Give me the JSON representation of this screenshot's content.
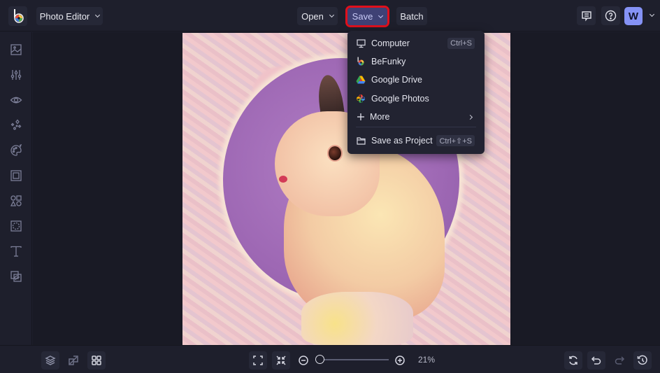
{
  "header": {
    "app_name": "Photo Editor",
    "open_label": "Open",
    "save_label": "Save",
    "batch_label": "Batch",
    "avatar_initial": "W"
  },
  "save_menu": {
    "items": [
      {
        "label": "Computer",
        "icon": "monitor-icon",
        "shortcut": "Ctrl+S"
      },
      {
        "label": "BeFunky",
        "icon": "befunky-logo-icon",
        "shortcut": ""
      },
      {
        "label": "Google Drive",
        "icon": "google-drive-icon",
        "shortcut": ""
      },
      {
        "label": "Google Photos",
        "icon": "google-photos-icon",
        "shortcut": ""
      },
      {
        "label": "More",
        "icon": "plus-icon",
        "shortcut": "",
        "submenu": true
      },
      {
        "label": "Save as Project",
        "icon": "folder-icon",
        "shortcut": "Ctrl+⇧+S"
      }
    ]
  },
  "sidebar": {
    "items": [
      {
        "name": "image-manager",
        "icon": "image-icon"
      },
      {
        "name": "edit",
        "icon": "sliders-icon"
      },
      {
        "name": "touch-up",
        "icon": "eye-icon"
      },
      {
        "name": "effects",
        "icon": "sparkles-icon"
      },
      {
        "name": "artsy",
        "icon": "palette-icon"
      },
      {
        "name": "frames",
        "icon": "frame-icon"
      },
      {
        "name": "graphics",
        "icon": "shapes-icon"
      },
      {
        "name": "overlays",
        "icon": "overlay-icon"
      },
      {
        "name": "text",
        "icon": "text-icon"
      },
      {
        "name": "textures",
        "icon": "texture-icon"
      }
    ]
  },
  "bottom_bar": {
    "zoom_value": "21%",
    "zoom_fraction": 0.05
  },
  "colors": {
    "accent": "#3f4175",
    "highlight_border": "#e0101c",
    "avatar_bg": "#8592f5"
  }
}
